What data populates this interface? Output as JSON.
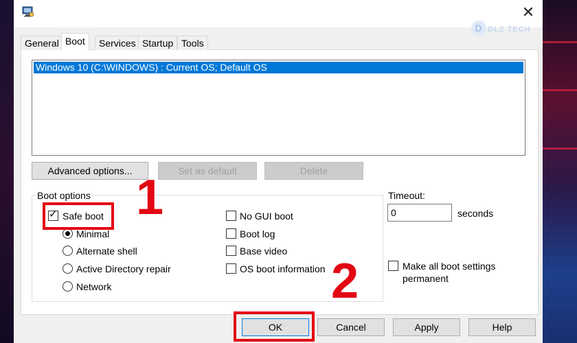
{
  "window": {
    "close_glyph": "✕",
    "watermark": "DLZ TECH"
  },
  "tabs": [
    {
      "label": "General",
      "active": false
    },
    {
      "label": "Boot",
      "active": true
    },
    {
      "label": "Services",
      "active": false
    },
    {
      "label": "Startup",
      "active": false
    },
    {
      "label": "Tools",
      "active": false
    }
  ],
  "boot": {
    "os_entries": [
      "Windows 10 (C:\\WINDOWS) : Current OS; Default OS"
    ],
    "buttons": {
      "advanced": "Advanced options...",
      "set_default": "Set as default",
      "delete": "Delete"
    },
    "boot_options": {
      "title": "Boot options",
      "safe_boot": {
        "label": "Safe boot",
        "checked": true
      },
      "safe_boot_modes": [
        {
          "label": "Minimal",
          "selected": true
        },
        {
          "label": "Alternate shell",
          "selected": false
        },
        {
          "label": "Active Directory repair",
          "selected": false
        },
        {
          "label": "Network",
          "selected": false
        }
      ],
      "flags": [
        {
          "label": "No GUI boot",
          "checked": false
        },
        {
          "label": "Boot log",
          "checked": false
        },
        {
          "label": "Base video",
          "checked": false
        },
        {
          "label": "OS boot information",
          "checked": false
        }
      ]
    },
    "timeout": {
      "label": "Timeout:",
      "value": "0",
      "unit": "seconds"
    },
    "permanent": {
      "label_line1": "Make all boot settings",
      "label_line2": "permanent",
      "checked": false
    }
  },
  "footer": {
    "ok": "OK",
    "cancel": "Cancel",
    "apply": "Apply",
    "help": "Help"
  },
  "annotations": {
    "step1": "1",
    "step2": "2",
    "highlight_color": "#e30613"
  },
  "colors": {
    "selection": "#0078d7",
    "dialog_bg": "#f0f0f0"
  }
}
